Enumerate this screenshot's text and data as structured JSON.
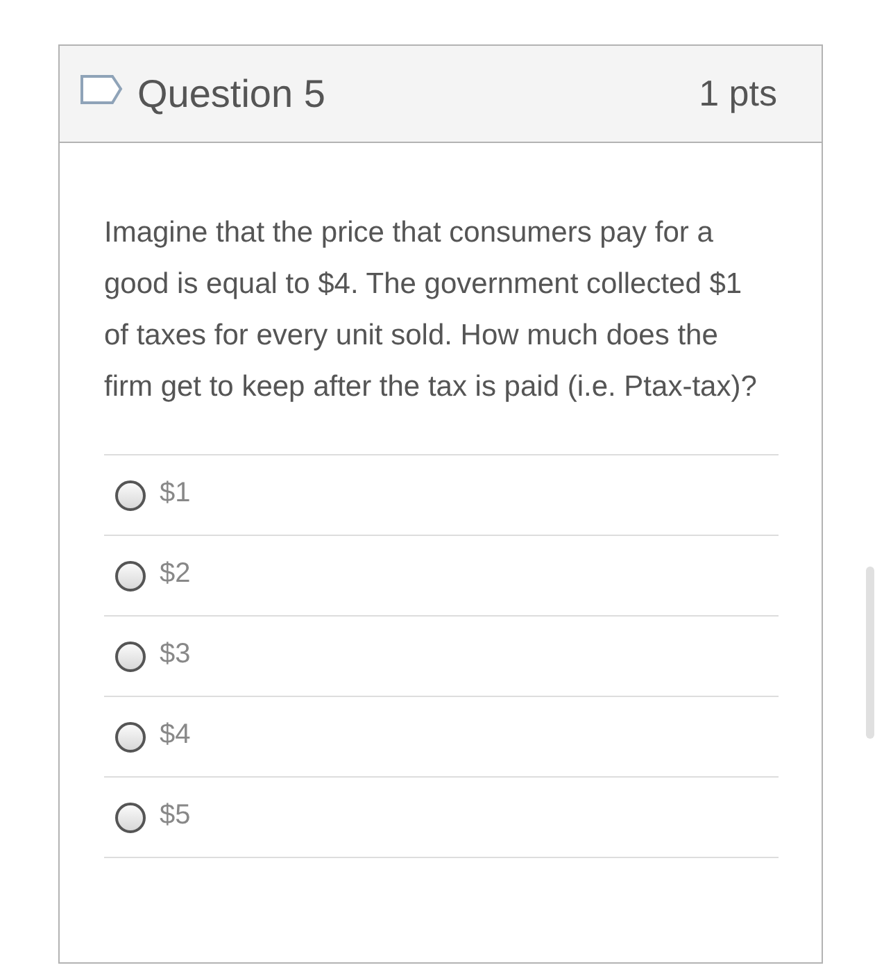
{
  "question": {
    "title": "Question 5",
    "points": "1 pts",
    "text": "Imagine that the price that consumers pay for a good is equal to $4. The government collected $1 of taxes for every unit sold. How much does the firm get to keep after the tax is paid (i.e. Ptax-tax)?"
  },
  "options": [
    {
      "label": "$1",
      "selected": false
    },
    {
      "label": "$2",
      "selected": false
    },
    {
      "label": "$3",
      "selected": false
    },
    {
      "label": "$4",
      "selected": false
    },
    {
      "label": "$5",
      "selected": false
    }
  ]
}
